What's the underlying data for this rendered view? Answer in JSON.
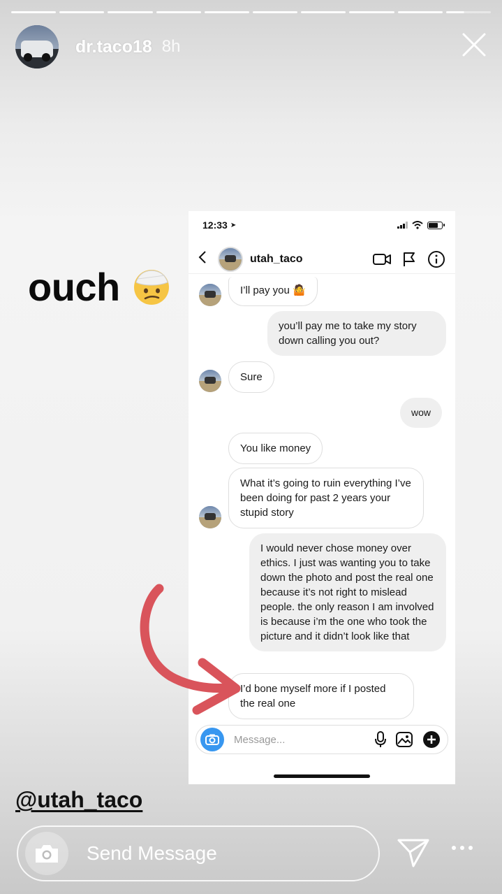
{
  "story": {
    "username": "dr.taco18",
    "time": "8h",
    "progress_segments": 10,
    "current_segment_progress": 0.4
  },
  "overlay": {
    "caption": "ouch",
    "emoji": "face-with-head-bandage",
    "mention": "@utah_taco"
  },
  "screenshot": {
    "status_time": "12:33",
    "dm_username": "utah_taco",
    "messages": [
      {
        "side": "in",
        "text": "I’ll pay you 🤷"
      },
      {
        "side": "out",
        "text": "you’ll pay me to take my story down calling you out?"
      },
      {
        "side": "in",
        "text": "Sure"
      },
      {
        "side": "out",
        "text": "wow"
      },
      {
        "side": "in",
        "text": "You like money"
      },
      {
        "side": "in",
        "text": "What it’s going to ruin everything I’ve been doing for past 2 years your stupid story"
      },
      {
        "side": "out",
        "text": "I would never chose money over ethics. I just was wanting you to take down the photo and post the real one because it’s not right to mislead people. the only reason I am involved is because i’m the one who took the picture and it didn’t look like that"
      },
      {
        "side": "in",
        "text": "I’d bone myself more if I posted the real one"
      }
    ],
    "composer_placeholder": "Message..."
  },
  "reply": {
    "placeholder": "Send Message"
  },
  "colors": {
    "accent_blue": "#3897f0",
    "arrow_red": "#d9545b"
  }
}
